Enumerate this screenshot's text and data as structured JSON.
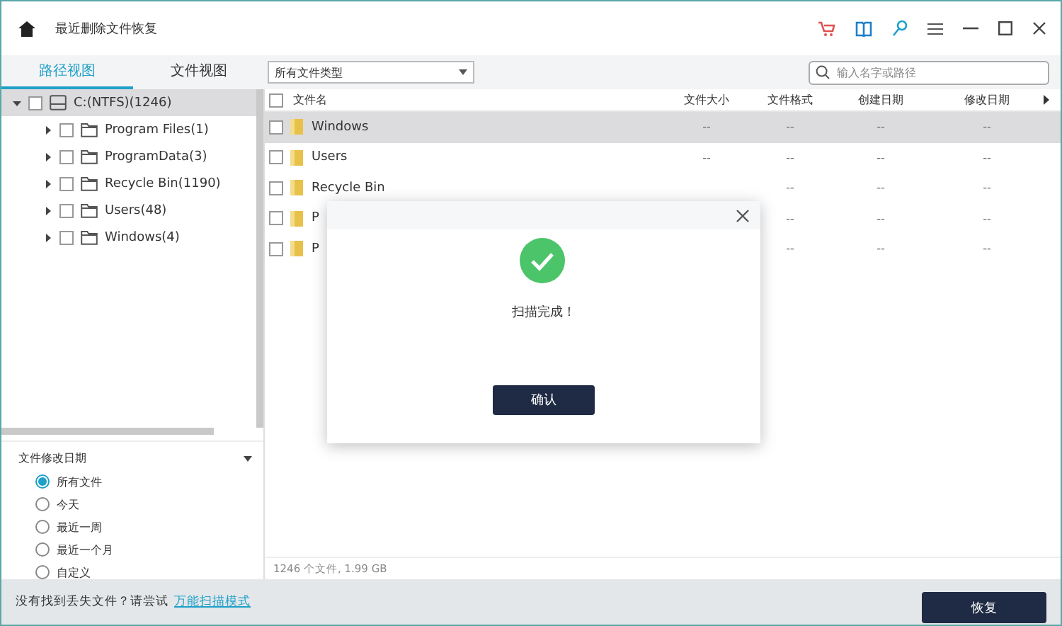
{
  "window": {
    "title": "最近删除文件恢复"
  },
  "tabs": [
    {
      "label": "路径视图",
      "selected": true
    },
    {
      "label": "文件视图",
      "selected": false
    }
  ],
  "type_filter": {
    "value": "所有文件类型"
  },
  "search": {
    "placeholder": "输入名字或路径"
  },
  "tree": [
    {
      "label": "C:(NTFS)(1246)",
      "kind": "drive",
      "expanded": true,
      "checked": false,
      "selected": true,
      "children": [
        {
          "label": "Program Files(1)",
          "kind": "folder",
          "expanded": false,
          "checked": false,
          "selected": false
        },
        {
          "label": "ProgramData(3)",
          "kind": "folder",
          "expanded": false,
          "checked": false,
          "selected": false
        },
        {
          "label": "Recycle Bin(1190)",
          "kind": "folder",
          "expanded": false,
          "checked": false,
          "selected": false
        },
        {
          "label": "Users(48)",
          "kind": "folder",
          "expanded": false,
          "checked": false,
          "selected": false
        },
        {
          "label": "Windows(4)",
          "kind": "folder",
          "expanded": false,
          "checked": false,
          "selected": false
        }
      ]
    }
  ],
  "date_filter": {
    "title": "文件修改日期",
    "options": [
      {
        "label": "所有文件",
        "selected": true
      },
      {
        "label": "今天",
        "selected": false
      },
      {
        "label": "最近一周",
        "selected": false
      },
      {
        "label": "最近一个月",
        "selected": false
      },
      {
        "label": "自定义",
        "selected": false
      }
    ]
  },
  "table": {
    "all_checked": false,
    "columns": [
      "文件名",
      "文件大小",
      "文件格式",
      "创建日期",
      "修改日期"
    ],
    "rows": [
      {
        "name": "Windows",
        "size": "--",
        "format": "--",
        "created": "--",
        "modified": "--",
        "checked": false,
        "selected": true
      },
      {
        "name": "Users",
        "size": "--",
        "format": "--",
        "created": "--",
        "modified": "--",
        "checked": false,
        "selected": false
      },
      {
        "name": "Recycle Bin",
        "format": "--",
        "created": "--",
        "modified": "--",
        "checked": false,
        "selected": false
      },
      {
        "name": "P",
        "format": "--",
        "created": "--",
        "modified": "--",
        "checked": false,
        "selected": false
      },
      {
        "name": "P",
        "format": "--",
        "created": "--",
        "modified": "--",
        "checked": false,
        "selected": false
      }
    ]
  },
  "status": "1246 个文件, 1.99 GB",
  "footer": {
    "text": "没有找到丢失文件？请尝试",
    "link": "万能扫描模式",
    "button": "恢复"
  },
  "dialog": {
    "message": "扫描完成！",
    "button": "确认"
  }
}
